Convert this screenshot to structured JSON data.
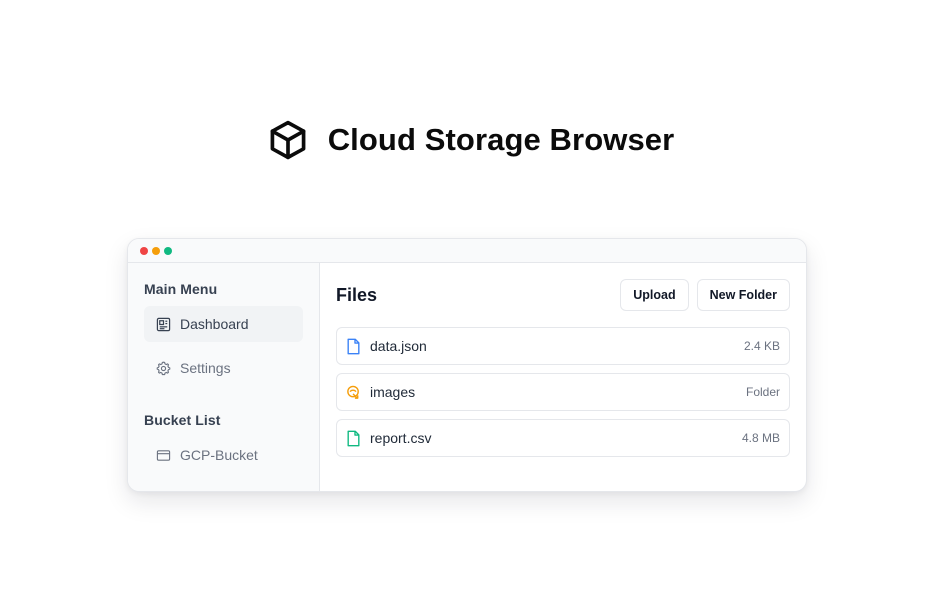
{
  "hero": {
    "title": "Cloud Storage Browser",
    "icon": "cube-icon"
  },
  "window": {
    "controls": [
      {
        "name": "close",
        "color": "#ef4444"
      },
      {
        "name": "minimize",
        "color": "#f59e0b"
      },
      {
        "name": "maximize",
        "color": "#10b981"
      }
    ]
  },
  "sidebar": {
    "main_menu_title": "Main Menu",
    "items": [
      {
        "label": "Dashboard",
        "icon": "dashboard-icon",
        "active": true
      },
      {
        "label": "Settings",
        "icon": "gear-icon",
        "active": false
      }
    ],
    "bucket_list_title": "Bucket List",
    "buckets": [
      {
        "label": "GCP-Bucket",
        "icon": "bucket-icon"
      }
    ]
  },
  "main": {
    "title": "Files",
    "upload_label": "Upload",
    "new_folder_label": "New Folder",
    "files": [
      {
        "name": "data.json",
        "meta": "2.4 KB",
        "icon": "file-icon",
        "color": "#3b82f6"
      },
      {
        "name": "images",
        "meta": "Folder",
        "icon": "folder-icon",
        "color": "#f59e0b"
      },
      {
        "name": "report.csv",
        "meta": "4.8 MB",
        "icon": "file-icon",
        "color": "#10b981"
      }
    ]
  }
}
